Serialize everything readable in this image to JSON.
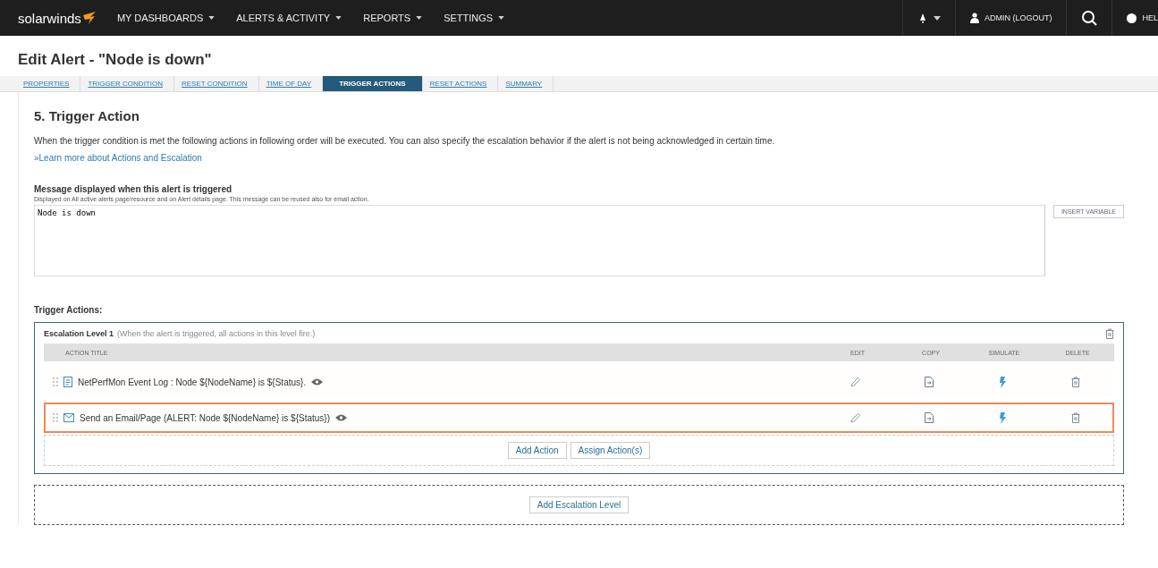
{
  "nav": {
    "logo": "solarwinds",
    "menus": [
      {
        "label": "MY DASHBOARDS"
      },
      {
        "label": "ALERTS & ACTIVITY"
      },
      {
        "label": "REPORTS"
      },
      {
        "label": "SETTINGS"
      }
    ],
    "user": "ADMIN (LOGOUT)",
    "help": "HEL"
  },
  "page_title": "Edit Alert - \"Node is down\"",
  "steps": [
    {
      "label": "PROPERTIES",
      "selected": false
    },
    {
      "label": "TRIGGER CONDITION",
      "selected": false
    },
    {
      "label": "RESET CONDITION",
      "selected": false
    },
    {
      "label": "TIME OF DAY",
      "selected": false
    },
    {
      "label": "TRIGGER ACTIONS",
      "selected": true
    },
    {
      "label": "RESET ACTIONS",
      "selected": false
    },
    {
      "label": "SUMMARY",
      "selected": false
    }
  ],
  "section": {
    "heading": "5. Trigger Action",
    "description": "When the trigger condition is met the following actions in following order will be executed. You can also specify the escalation behavior if the alert is not being acknowledged in certain time.",
    "link": "»Learn more about Actions and Escalation"
  },
  "message": {
    "label": "Message displayed when this alert is triggered",
    "hint": "Displayed on All active alerts page/resource and on Alert details page. This message can be reused also for email action.",
    "value": "Node is down",
    "insert_button": "INSERT VARIABLE"
  },
  "trigger_actions": {
    "label": "Trigger Actions:",
    "escalation": {
      "title": "Escalation Level 1",
      "note": "(When the alert is triggered, all actions in this level fire.)",
      "columns": [
        "ACTION TITLE",
        "EDIT",
        "COPY",
        "SIMULATE",
        "DELETE"
      ],
      "rows": [
        {
          "kind": "event-log",
          "title": "NetPerfMon Event Log : Node ${NodeName} is ${Status}.",
          "highlighted": false
        },
        {
          "kind": "email",
          "title": "Send an Email/Page (ALERT: Node ${NodeName} is ${Status})",
          "highlighted": true
        }
      ],
      "buttons": [
        "Add Action",
        "Assign Action(s)"
      ]
    },
    "add_level_button": "Add Escalation Level"
  }
}
